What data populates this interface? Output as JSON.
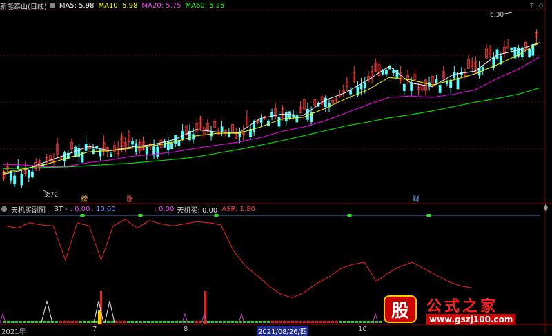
{
  "main_header": {
    "title": "新能泰山(日线)",
    "ma5": "MA5: 5.98",
    "ma10": "MA10: 5.98",
    "ma20": "MA20: 5.75",
    "ma60": "MA60: 5.25",
    "colors": {
      "ma5": "#ffffff",
      "ma10": "#ffff00",
      "ma20": "#ff00ff",
      "ma60": "#00ff00"
    }
  },
  "sub_header": {
    "title": "天机买副图",
    "bt": "BT",
    "bt_dash": "-",
    "v1": ": 0.00",
    "v2": ": 10.00",
    "v3": ": 0.00",
    "tianji": "天机买: 0.00",
    "asr": "ASR: 1.80"
  },
  "annotations": {
    "high": "6.30",
    "low": "3.72",
    "tag_bang": "榜",
    "tag_zhang": "涨",
    "tag_cai": "财"
  },
  "xaxis": {
    "labels": [
      "2021年",
      "7",
      "8",
      "2021/08/26/四",
      "10"
    ]
  },
  "watermark": {
    "logo_char": "股",
    "name": "公式之家",
    "url": "www.gszj100.com"
  },
  "chart_data": [
    {
      "type": "candlestick",
      "title": "新能泰山(日线)",
      "series": [
        {
          "name": "MA5",
          "values": [
            3.86,
            3.93,
            4.06,
            4.18,
            4.31,
            4.24,
            4.3,
            4.34,
            4.42,
            4.58,
            4.54,
            4.53,
            4.76,
            4.83,
            4.81,
            5.05,
            5.18,
            5.38,
            5.6,
            5.33,
            5.27,
            5.47,
            5.52,
            5.78,
            5.86,
            5.98
          ]
        },
        {
          "name": "MA10",
          "values": [
            3.88,
            3.95,
            4.02,
            4.12,
            4.22,
            4.24,
            4.28,
            4.32,
            4.38,
            4.48,
            4.52,
            4.52,
            4.62,
            4.75,
            4.78,
            4.92,
            5.08,
            5.22,
            5.42,
            5.38,
            5.3,
            5.38,
            5.48,
            5.62,
            5.78,
            5.98
          ]
        },
        {
          "name": "MA20",
          "values": [
            4.02,
            4.01,
            3.98,
            3.99,
            4.05,
            4.09,
            4.15,
            4.18,
            4.22,
            4.28,
            4.33,
            4.38,
            4.45,
            4.55,
            4.62,
            4.72,
            4.85,
            4.98,
            5.1,
            5.12,
            5.1,
            5.15,
            5.22,
            5.4,
            5.55,
            5.75
          ]
        },
        {
          "name": "MA60",
          "values": [
            3.95,
            3.96,
            3.97,
            3.98,
            4.0,
            4.02,
            4.04,
            4.07,
            4.1,
            4.14,
            4.2,
            4.26,
            4.33,
            4.4,
            4.48,
            4.56,
            4.64,
            4.7,
            4.77,
            4.82,
            4.88,
            4.95,
            5.02,
            5.08,
            5.15,
            5.25
          ]
        }
      ],
      "high_marker": 6.3,
      "low_marker": 3.72
    },
    {
      "type": "line",
      "title": "天机买副图",
      "series": [
        {
          "name": "ASR",
          "values": [
            92,
            90,
            95,
            93,
            92,
            60,
            95,
            92,
            60,
            92,
            98,
            90,
            97,
            94,
            92,
            94,
            96,
            95,
            93,
            70,
            55,
            46,
            36,
            28,
            25,
            30,
            38,
            44,
            52,
            56,
            58,
            40,
            48,
            54,
            58,
            52,
            46,
            40,
            36,
            34
          ]
        }
      ]
    }
  ]
}
